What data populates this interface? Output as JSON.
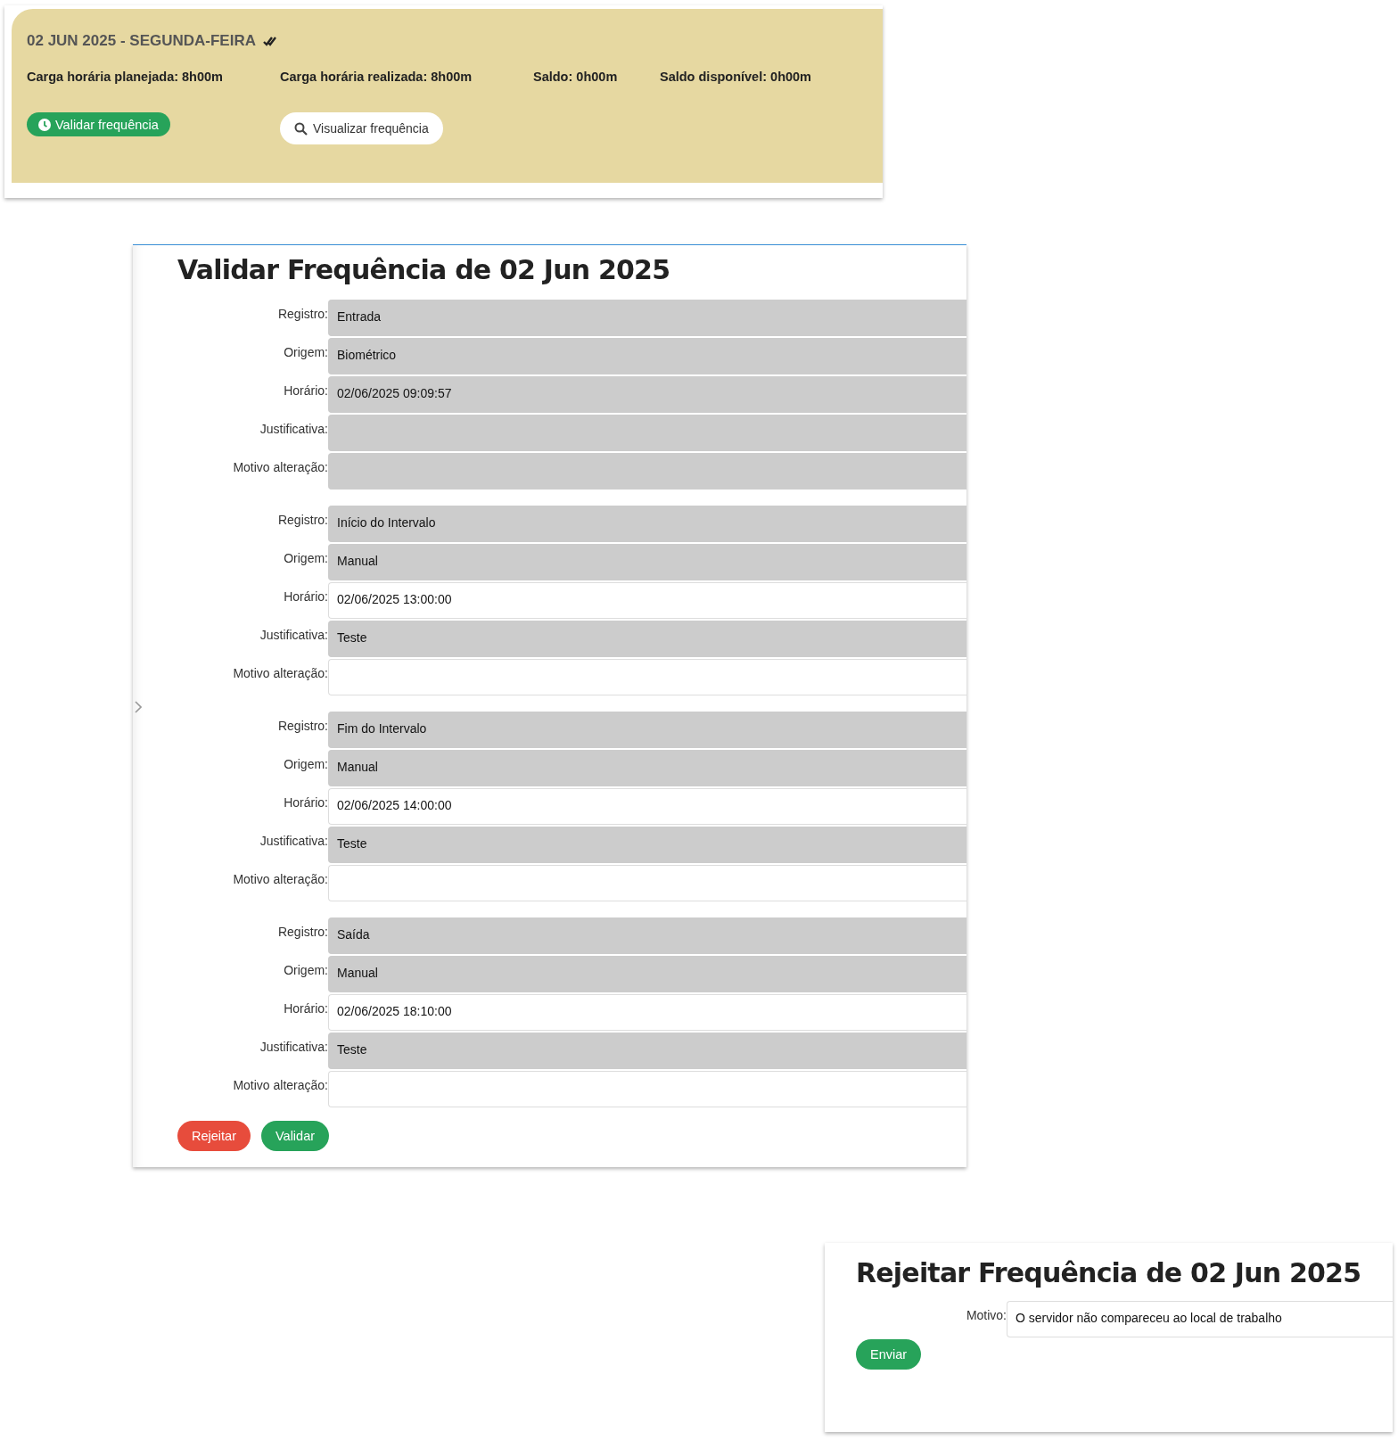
{
  "day_card": {
    "title": "02 JUN 2025 - SEGUNDA-FEIRA",
    "validated": true,
    "stats": [
      "Carga horária planejada: 8h00m",
      "Carga horária realizada: 8h00m",
      "Saldo: 0h00m",
      "Saldo disponível: 0h00m"
    ],
    "validate_button": "Validar frequência",
    "view_button": "Visualizar frequência"
  },
  "validate_dialog": {
    "title": "Validar Frequência de 02 Jun 2025",
    "entries": [
      {
        "fields": [
          {
            "label": "Registro:",
            "value": "Entrada",
            "disabled": true
          },
          {
            "label": "Origem:",
            "value": "Biométrico",
            "disabled": true
          },
          {
            "label": "Horário:",
            "value": "02/06/2025 09:09:57",
            "disabled": true
          },
          {
            "label": "Justificativa:",
            "disabled": true
          },
          {
            "label": "Motivo alteração:",
            "disabled": true
          }
        ]
      },
      {
        "fields": [
          {
            "label": "Registro:",
            "value": "Início do Intervalo",
            "disabled": true
          },
          {
            "label": "Origem:",
            "value": "Manual",
            "disabled": true
          },
          {
            "label": "Horário:",
            "value": "02/06/2025 13:00:00",
            "disabled": false
          },
          {
            "label": "Justificativa:",
            "value": "Teste",
            "disabled": true
          },
          {
            "label": "Motivo alteração:",
            "disabled": false
          }
        ]
      },
      {
        "fields": [
          {
            "label": "Registro:",
            "value": "Fim do Intervalo",
            "disabled": true
          },
          {
            "label": "Origem:",
            "value": "Manual",
            "disabled": true
          },
          {
            "label": "Horário:",
            "value": "02/06/2025 14:00:00",
            "disabled": false
          },
          {
            "label": "Justificativa:",
            "value": "Teste",
            "disabled": true
          },
          {
            "label": "Motivo alteração:",
            "disabled": false
          }
        ]
      },
      {
        "fields": [
          {
            "label": "Registro:",
            "value": "Saída",
            "disabled": true
          },
          {
            "label": "Origem:",
            "value": "Manual",
            "disabled": true
          },
          {
            "label": "Horário:",
            "value": "02/06/2025 18:10:00",
            "disabled": false
          },
          {
            "label": "Justificativa:",
            "value": "Teste",
            "disabled": true
          },
          {
            "label": "Motivo alteração:",
            "disabled": false
          }
        ]
      }
    ],
    "buttons": [
      {
        "label": "Rejeitar",
        "kind": "danger"
      },
      {
        "label": "Validar",
        "kind": "primary"
      }
    ]
  },
  "reject_dialog": {
    "title": "Rejeitar Frequência de 02 Jun 2025",
    "field": {
      "label": "Motivo:",
      "value": "O servidor não compareceu ao local de trabalho"
    },
    "button": "Enviar"
  }
}
